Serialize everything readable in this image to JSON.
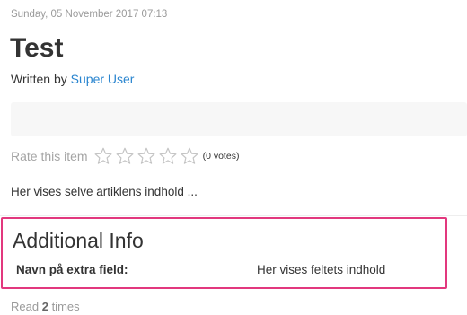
{
  "article": {
    "date": "Sunday, 05 November 2017 07:13",
    "title": "Test",
    "byline_prefix": "Written by",
    "author": "Super User",
    "fulltext": "Her vises selve artiklens indhold ..."
  },
  "rating": {
    "label": "Rate this item",
    "stars": 5,
    "current": 0,
    "votes_text": "(0 votes)",
    "star_icon": "star-outline-icon"
  },
  "extra_fields": {
    "heading": "Additional Info",
    "items": [
      {
        "label": "Navn på extra field:",
        "value": "Her vises feltets indhold"
      }
    ],
    "highlight_color": "#e2387e"
  },
  "hits": {
    "prefix": "Read",
    "count": "2",
    "suffix": "times"
  },
  "colors": {
    "link": "#2a85cf",
    "muted": "#9a9a9a",
    "text": "#333333"
  }
}
